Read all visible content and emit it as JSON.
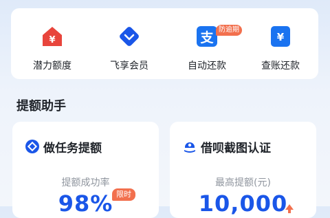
{
  "quick_actions": [
    {
      "label": "潜力额度",
      "icon": "house-yen-icon",
      "color": "#e8453c"
    },
    {
      "label": "飞享会员",
      "icon": "diamond-icon",
      "color": "#1a56e8"
    },
    {
      "label": "自动还款",
      "icon": "alipay-icon",
      "color": "#1a73f0",
      "badge": "防逾期"
    },
    {
      "label": "查账还款",
      "icon": "yen-card-icon",
      "color": "#1a73f0"
    }
  ],
  "section": {
    "title": "提额助手"
  },
  "cards": [
    {
      "title": "做任务提额",
      "icon": "task-diamond-icon",
      "subtitle": "提额成功率",
      "value": "98%",
      "tag": "限时"
    },
    {
      "title": "借呗截图认证",
      "icon": "upload-cloud-icon",
      "subtitle": "最高提额(元)",
      "value": "10,000"
    }
  ],
  "colors": {
    "accent": "#1a56e8",
    "badge": "#f2704e"
  }
}
